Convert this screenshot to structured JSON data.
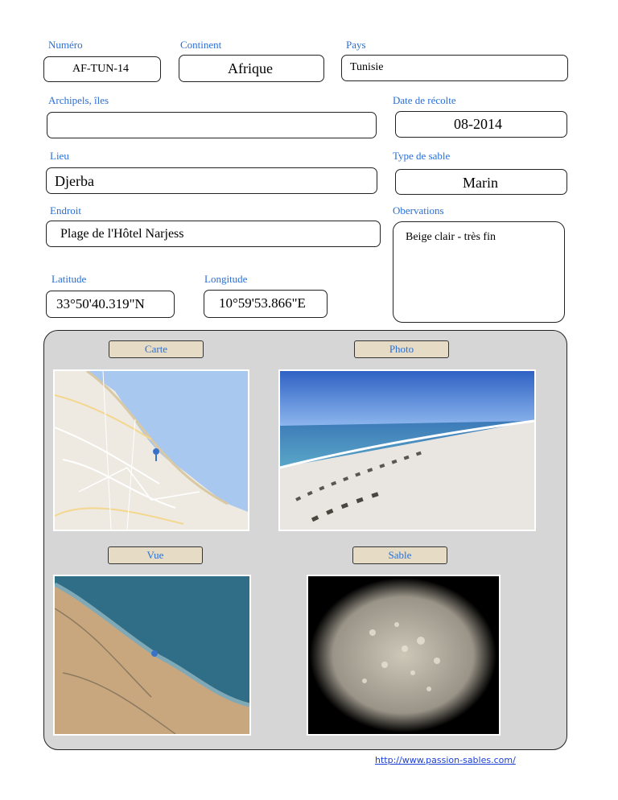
{
  "labels": {
    "numero": "Numéro",
    "continent": "Continent",
    "pays": "Pays",
    "archipels": "Archipels, îles",
    "date": "Date de récolte",
    "lieu": "Lieu",
    "type": "Type de sable",
    "endroit": "Endroit",
    "observations": "Obervations",
    "latitude": "Latitude",
    "longitude": "Longitude"
  },
  "values": {
    "numero": "AF-TUN-14",
    "continent": "Afrique",
    "pays": "Tunisie",
    "archipels": "",
    "date": "08-2014",
    "lieu": "Djerba",
    "type": "Marin",
    "endroit": "Plage de l'Hôtel Narjess",
    "observations": "Beige clair - très fin",
    "latitude": "33°50'40.319\"N",
    "longitude": "10°59'53.866\"E"
  },
  "panel": {
    "carte": "Carte",
    "photo": "Photo",
    "vue": "Vue",
    "sable": "Sable"
  },
  "footer": {
    "url": "http://www.passion-sables.com/"
  }
}
